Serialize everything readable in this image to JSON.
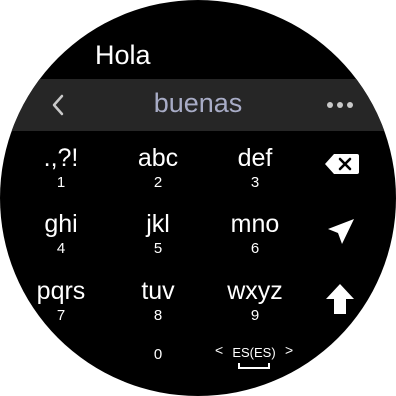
{
  "input": {
    "text": "Hola"
  },
  "suggestion_bar": {
    "word": "buenas"
  },
  "keys": [
    {
      "label": ".,?!",
      "number": "1"
    },
    {
      "label": "abc",
      "number": "2"
    },
    {
      "label": "def",
      "number": "3"
    },
    {
      "label": "ghi",
      "number": "4"
    },
    {
      "label": "jkl",
      "number": "5"
    },
    {
      "label": "mno",
      "number": "6"
    },
    {
      "label": "pqrs",
      "number": "7"
    },
    {
      "label": "tuv",
      "number": "8"
    },
    {
      "label": "wxyz",
      "number": "9"
    },
    {
      "label": "",
      "number": "0"
    }
  ],
  "language": {
    "code": "ES(ES)",
    "prev": "<",
    "next": ">"
  },
  "icons": {
    "back": "chevron-left-icon",
    "more": "more-horizontal-icon",
    "backspace": "backspace-icon",
    "send": "send-icon",
    "shift": "shift-icon"
  },
  "colors": {
    "background": "#000000",
    "suggestion_bar": "#262626",
    "suggestion_text": "#a8acc6"
  }
}
